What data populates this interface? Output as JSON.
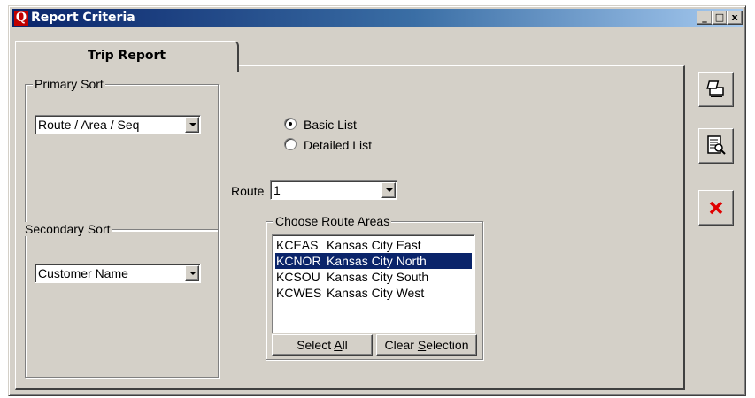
{
  "window": {
    "icon_letter": "Q",
    "title": "Report Criteria",
    "minimize": "_",
    "maximize": "□",
    "close": "x"
  },
  "tab": {
    "label": "Trip Report"
  },
  "primary_sort": {
    "legend": "Primary Sort",
    "selected": "Route / Area / Seq"
  },
  "secondary_sort": {
    "legend": "Secondary Sort",
    "selected": "Customer Name"
  },
  "list_type": {
    "options": [
      {
        "label": "Basic List",
        "selected": true
      },
      {
        "label": "Detailed List",
        "selected": false
      }
    ]
  },
  "route": {
    "label": "Route",
    "selected": "1"
  },
  "route_areas": {
    "legend": "Choose Route Areas",
    "items": [
      {
        "code": "KCEAS",
        "name": "Kansas City East",
        "selected": false
      },
      {
        "code": "KCNOR",
        "name": "Kansas City North",
        "selected": true
      },
      {
        "code": "KCSOU",
        "name": "Kansas City South",
        "selected": false
      },
      {
        "code": "KCWES",
        "name": "Kansas City West",
        "selected": false
      }
    ],
    "select_all_prefix": "Select ",
    "select_all_key": "A",
    "select_all_suffix": "ll",
    "clear_prefix": "Clear ",
    "clear_key": "S",
    "clear_suffix": "election"
  },
  "side_buttons": {
    "print_icon": "printer-icon",
    "preview_icon": "preview-icon",
    "close_icon": "close-x-icon",
    "close_color": "#e00000"
  },
  "colors": {
    "title_gradient_start": "#0a246a",
    "selection": "#0a246a",
    "face": "#d4d0c8"
  }
}
